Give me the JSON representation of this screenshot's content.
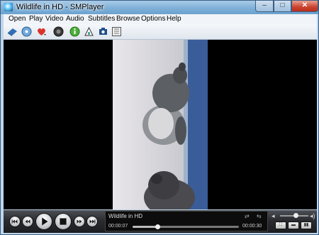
{
  "window": {
    "title": "Wildlife in HD - SMPlayer",
    "minimize": "–",
    "maximize": "□",
    "close": "✕"
  },
  "menu": [
    "Open",
    "Play",
    "Video",
    "Audio",
    "Subtitles",
    "Browse",
    "Options",
    "Help"
  ],
  "toolbar": [
    "open-file-icon",
    "open-dvd-icon",
    "favorites-icon",
    "record-icon",
    "info-icon",
    "equalizer-icon",
    "screenshot-icon",
    "playlist-icon"
  ],
  "player": {
    "media_title": "Wildlife in HD",
    "elapsed": "00:00:07",
    "total": "00:00:30",
    "progress": 0.23,
    "volume": 0.55
  },
  "colors": {
    "control_bg": "#2a2c30",
    "titlebar": "#7fb0d8",
    "video_bg": "#000000"
  }
}
